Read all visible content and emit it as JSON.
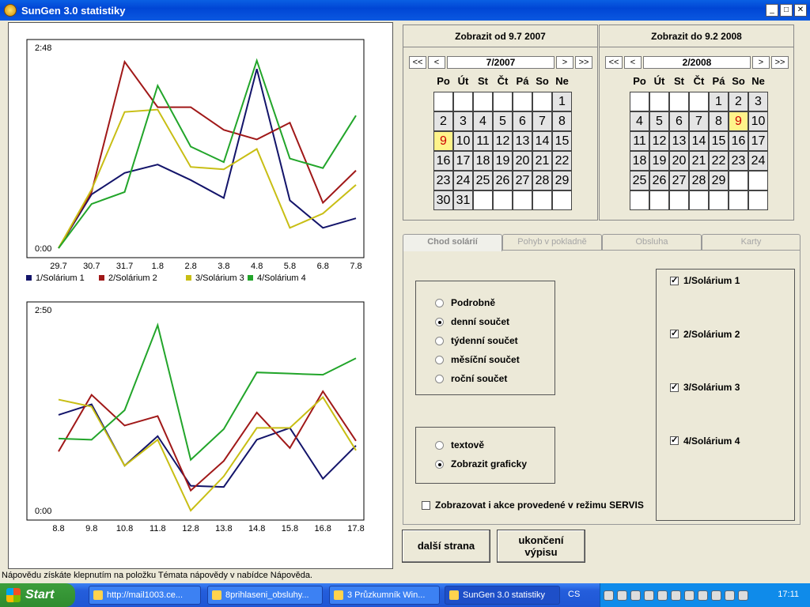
{
  "window": {
    "title": "SunGen 3.0 statistiky"
  },
  "colors": {
    "s1": "#13146A",
    "s2": "#A01818",
    "s3": "#C8BE14",
    "s4": "#22A52A"
  },
  "legend": [
    "1/Solárium 1",
    "2/Solárium 2",
    "3/Solárium 3",
    "4/Solárium 4"
  ],
  "chart_data": [
    {
      "type": "line",
      "title": "",
      "xlabel": "",
      "ylabel": "",
      "categories": [
        "29.7",
        "30.7",
        "31.7",
        "1.8",
        "2.8",
        "3.8",
        "4.8",
        "5.8",
        "6.8",
        "7.8"
      ],
      "y_labels": {
        "top": "2:48",
        "bottom": "0:00"
      },
      "ylim": [
        0,
        168
      ],
      "grid": false,
      "legend": "bottom",
      "series": [
        {
          "name": "1/Solárium 1",
          "values": [
            0,
            45,
            63,
            70,
            57,
            42,
            150,
            40,
            17,
            25
          ]
        },
        {
          "name": "2/Solárium 2",
          "values": [
            0,
            47,
            156,
            118,
            118,
            99,
            91,
            105,
            38,
            65
          ]
        },
        {
          "name": "3/Solárium 3",
          "values": [
            0,
            49,
            114,
            116,
            68,
            66,
            83,
            17,
            29,
            53
          ]
        },
        {
          "name": "4/Solárium 4",
          "values": [
            0,
            37,
            47,
            136,
            85,
            72,
            157,
            75,
            67,
            111
          ]
        }
      ]
    },
    {
      "type": "line",
      "title": "",
      "xlabel": "",
      "ylabel": "",
      "categories": [
        "8.8",
        "9.8",
        "10.8",
        "11.8",
        "12.8",
        "13.8",
        "14.8",
        "15.8",
        "16.8",
        "17.8"
      ],
      "y_labels": {
        "top": "2:50",
        "bottom": "0:00"
      },
      "ylim": [
        0,
        170
      ],
      "grid": false,
      "series": [
        {
          "name": "1/Solárium 1",
          "values": [
            81,
            90,
            38,
            63,
            21,
            20,
            60,
            70,
            27,
            55
          ]
        },
        {
          "name": "2/Solárium 2",
          "values": [
            50,
            98,
            72,
            80,
            17,
            42,
            83,
            53,
            101,
            59
          ]
        },
        {
          "name": "3/Solárium 3",
          "values": [
            94,
            88,
            38,
            60,
            0,
            29,
            70,
            70,
            96,
            51
          ]
        },
        {
          "name": "4/Solárium 4",
          "values": [
            61,
            60,
            85,
            157,
            43,
            69,
            117,
            116,
            115,
            129
          ]
        }
      ]
    }
  ],
  "calendars": [
    {
      "header": "Zobrazit od 9.7 2007",
      "month": "7/2007",
      "offset": 6,
      "days": 31,
      "hl": 9
    },
    {
      "header": "Zobrazit do 9.2 2008",
      "month": "2/2008",
      "offset": 4,
      "days": 29,
      "hl": 9
    }
  ],
  "nav": {
    "first": "<<",
    "prev": "<",
    "next": ">",
    "last": ">>"
  },
  "weekdays": [
    "Po",
    "Út",
    "St",
    "Čt",
    "Pá",
    "So",
    "Ne"
  ],
  "tabs": [
    "Chod solárií",
    "Pohyb v pokladně",
    "Obsluha",
    "Karty"
  ],
  "detail_options": [
    "Podrobně",
    "denní součet",
    "týdenní součet",
    "měsíční součet",
    "roční součet"
  ],
  "detail_selected": 1,
  "view_options": [
    "textově",
    "Zobrazit graficky"
  ],
  "view_selected": 1,
  "servis_label": "Zobrazovat i akce provedené v režimu SERVIS",
  "solaria": [
    "1/Solárium 1",
    "2/Solárium 2",
    "3/Solárium 3",
    "4/Solárium 4"
  ],
  "buttons": {
    "next": "další strana",
    "end_line1": "ukončení",
    "end_line2": "výpisu"
  },
  "status": "Nápovědu získáte klepnutím na položku Témata nápovědy v nabídce Nápověda.",
  "taskbar": {
    "start": "Start",
    "tasks": [
      "http://mail1003.ce...",
      "8prihlaseni_obsluhy...",
      "3 Průzkumník Win...",
      "SunGen 3.0 statistiky"
    ],
    "lang": "CS",
    "clock": "17:11"
  }
}
